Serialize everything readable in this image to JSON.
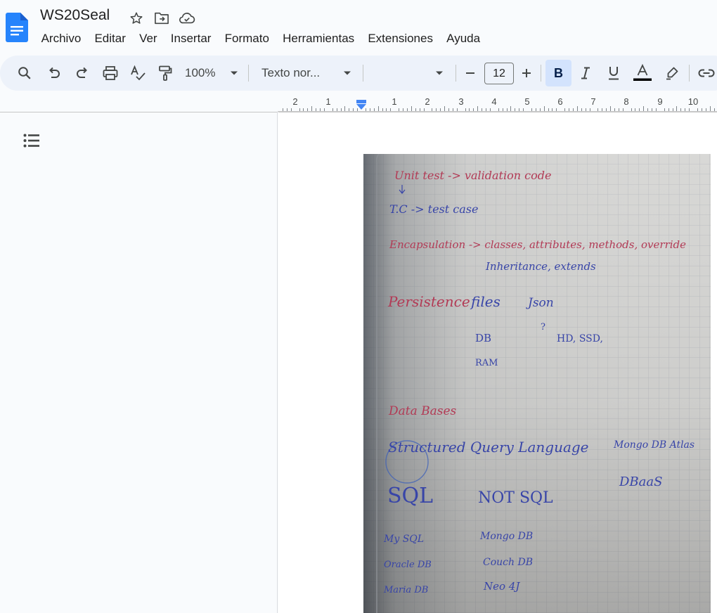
{
  "document": {
    "title": "WS20Seal"
  },
  "menu": [
    "Archivo",
    "Editar",
    "Ver",
    "Insertar",
    "Formato",
    "Herramientas",
    "Extensiones",
    "Ayuda"
  ],
  "toolbar": {
    "zoom": "100%",
    "paragraph_style": "Texto nor...",
    "font_family": "",
    "font_size": "12",
    "bold_label": "B",
    "text_color": "#000000",
    "accent": "#0b57d0"
  },
  "ruler": {
    "labels": [
      "2",
      "1",
      "1",
      "2",
      "3",
      "4",
      "5",
      "6",
      "7",
      "8",
      "9",
      "10"
    ]
  },
  "notebook_photo": {
    "lines": [
      "Unit test ->  validation code",
      "T.C -> test case",
      "Encapsulation -> classes, attributes, methods, override",
      "Inheritance, extends",
      "Persistence",
      "files",
      "Json",
      "?",
      "DB",
      "HD, SSD,",
      "RAM",
      "Data Bases",
      "Structured Query Language",
      "Mongo DB Atlas",
      "DBaaS",
      "SQL",
      "NOT SQL",
      "My SQL",
      "Mongo DB",
      "Oracle DB",
      "Couch DB",
      "Maria DB",
      "Neo 4J"
    ],
    "colors": {
      "red_ink": "#b23a55",
      "blue_ink": "#3845a8",
      "paper": "#d8d8d6"
    }
  }
}
